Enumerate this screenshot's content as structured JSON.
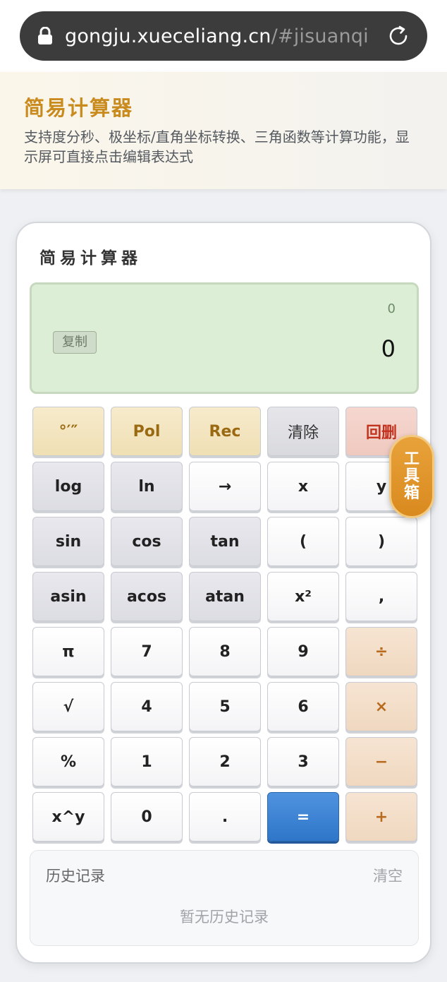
{
  "browser": {
    "url_host": "gongju.xueceliang.cn",
    "url_hash": "/#jisuanqi"
  },
  "banner": {
    "title": "简易计算器",
    "description": "支持度分秒、极坐标/直角坐标转换、三角函数等计算功能，显示屏可直接点击编辑表达式"
  },
  "calculator": {
    "title": "简易计算器",
    "display_expression": "0",
    "display_result": "0",
    "copy_label": "复制",
    "keys": [
      {
        "label": "°′″",
        "kind": "amber",
        "name": "key-dms"
      },
      {
        "label": "Pol",
        "kind": "amber",
        "name": "key-pol"
      },
      {
        "label": "Rec",
        "kind": "amber",
        "name": "key-rec"
      },
      {
        "label": "清除",
        "kind": "clear",
        "name": "key-clear"
      },
      {
        "label": "回删",
        "kind": "back",
        "name": "key-backspace"
      },
      {
        "label": "log",
        "kind": "func",
        "name": "key-log"
      },
      {
        "label": "ln",
        "kind": "func",
        "name": "key-ln"
      },
      {
        "label": "→",
        "kind": "plain",
        "name": "key-arrow"
      },
      {
        "label": "x",
        "kind": "plain",
        "name": "key-x"
      },
      {
        "label": "y",
        "kind": "plain",
        "name": "key-y"
      },
      {
        "label": "sin",
        "kind": "func",
        "name": "key-sin"
      },
      {
        "label": "cos",
        "kind": "func",
        "name": "key-cos"
      },
      {
        "label": "tan",
        "kind": "func",
        "name": "key-tan"
      },
      {
        "label": "(",
        "kind": "plain",
        "name": "key-open-paren"
      },
      {
        "label": ")",
        "kind": "plain",
        "name": "key-close-paren"
      },
      {
        "label": "asin",
        "kind": "func",
        "name": "key-asin"
      },
      {
        "label": "acos",
        "kind": "func",
        "name": "key-acos"
      },
      {
        "label": "atan",
        "kind": "func",
        "name": "key-atan"
      },
      {
        "label": "x²",
        "kind": "plain",
        "name": "key-square"
      },
      {
        "label": ",",
        "kind": "plain",
        "name": "key-comma"
      },
      {
        "label": "π",
        "kind": "plain",
        "name": "key-pi"
      },
      {
        "label": "7",
        "kind": "plain",
        "name": "key-7"
      },
      {
        "label": "8",
        "kind": "plain",
        "name": "key-8"
      },
      {
        "label": "9",
        "kind": "plain",
        "name": "key-9"
      },
      {
        "label": "÷",
        "kind": "op",
        "name": "key-divide"
      },
      {
        "label": "√",
        "kind": "plain",
        "name": "key-sqrt"
      },
      {
        "label": "4",
        "kind": "plain",
        "name": "key-4"
      },
      {
        "label": "5",
        "kind": "plain",
        "name": "key-5"
      },
      {
        "label": "6",
        "kind": "plain",
        "name": "key-6"
      },
      {
        "label": "×",
        "kind": "op",
        "name": "key-multiply"
      },
      {
        "label": "%",
        "kind": "plain",
        "name": "key-percent"
      },
      {
        "label": "1",
        "kind": "plain",
        "name": "key-1"
      },
      {
        "label": "2",
        "kind": "plain",
        "name": "key-2"
      },
      {
        "label": "3",
        "kind": "plain",
        "name": "key-3"
      },
      {
        "label": "−",
        "kind": "op",
        "name": "key-minus"
      },
      {
        "label": "x^y",
        "kind": "plain",
        "name": "key-power"
      },
      {
        "label": "0",
        "kind": "plain",
        "name": "key-0"
      },
      {
        "label": ".",
        "kind": "plain",
        "name": "key-decimal"
      },
      {
        "label": "=",
        "kind": "equals",
        "name": "key-equals"
      },
      {
        "label": "+",
        "kind": "op",
        "name": "key-plus"
      }
    ]
  },
  "history": {
    "title": "历史记录",
    "clear_label": "清空",
    "empty_text": "暂无历史记录"
  },
  "toolbox": {
    "label": "工具箱"
  },
  "colors": {
    "accent": "#c98a1e",
    "display_bg": "#dcefd6",
    "equals_bg": "#3a80d2",
    "backspace_text": "#c2321e",
    "toolbox_bg": "#e09428"
  },
  "icons": {
    "lock": "lock-icon",
    "reload": "reload-icon"
  }
}
